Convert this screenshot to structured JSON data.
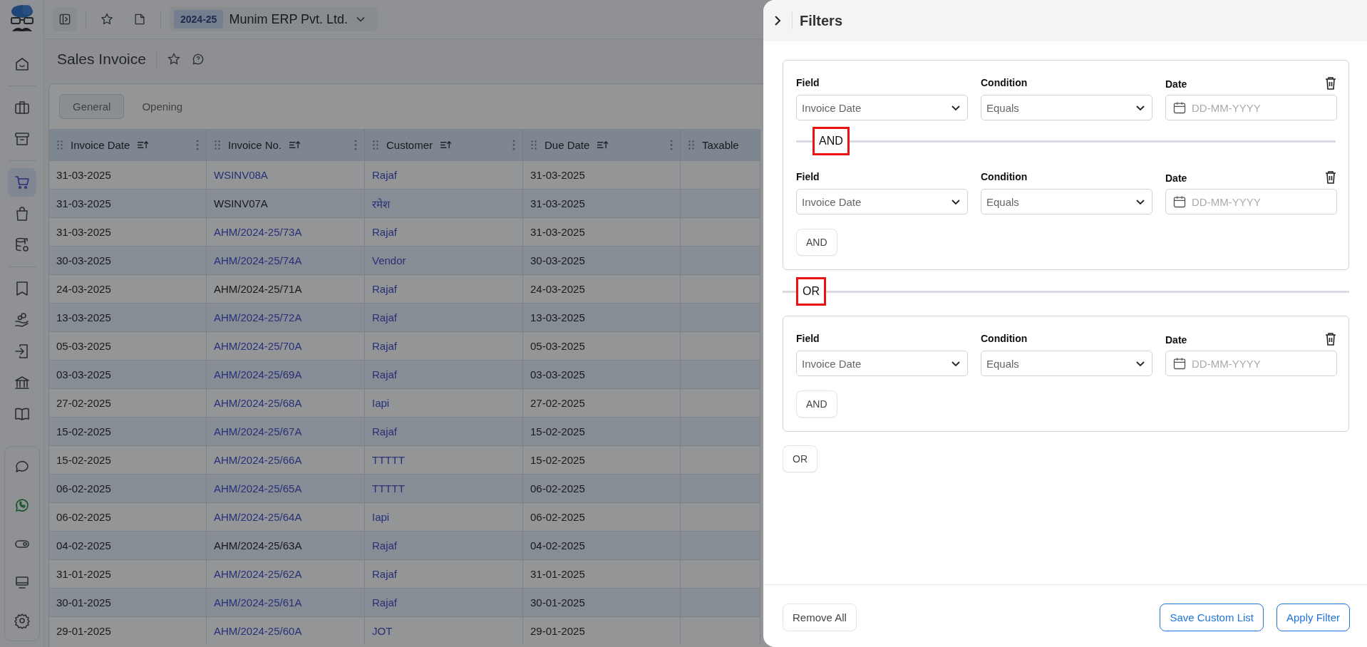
{
  "topbar": {
    "fiscal_year": "2024-25",
    "company": "Munim ERP Pvt. Ltd."
  },
  "sidebar": {
    "items": [
      {
        "selected": false
      },
      {
        "selected": false
      },
      {
        "selected": false
      },
      {
        "selected": true
      },
      {
        "selected": false
      },
      {
        "selected": false
      },
      {
        "selected": false
      },
      {
        "selected": false
      },
      {
        "selected": false
      },
      {
        "selected": false
      },
      {
        "selected": false
      }
    ],
    "bottom_items": [
      {
        "selected": false
      },
      {
        "selected": false
      },
      {
        "selected": false
      },
      {
        "selected": false
      },
      {
        "selected": false
      }
    ]
  },
  "page": {
    "title": "Sales Invoice"
  },
  "tabs": [
    {
      "label": "General",
      "selected": true
    },
    {
      "label": "Opening",
      "selected": false
    }
  ],
  "table": {
    "columns": [
      "Invoice Date",
      "Invoice No.",
      "Customer",
      "Due Date",
      "Taxable"
    ],
    "rows": [
      {
        "invoice_date": "31-03-2025",
        "invoice_no": "WSINV08A",
        "invoice_no_linked": true,
        "customer": "Rajaf",
        "due_date": "31-03-2025"
      },
      {
        "invoice_date": "31-03-2025",
        "invoice_no": "WSINV07A",
        "invoice_no_linked": false,
        "customer": "रमेश",
        "due_date": "31-03-2025"
      },
      {
        "invoice_date": "31-03-2025",
        "invoice_no": "AHM/2024-25/73A",
        "invoice_no_linked": true,
        "customer": "Rajaf",
        "due_date": "31-03-2025"
      },
      {
        "invoice_date": "30-03-2025",
        "invoice_no": "AHM/2024-25/74A",
        "invoice_no_linked": true,
        "customer": "Vendor",
        "due_date": "30-03-2025"
      },
      {
        "invoice_date": "24-03-2025",
        "invoice_no": "AHM/2024-25/71A",
        "invoice_no_linked": false,
        "customer": "Rajaf",
        "due_date": "24-03-2025"
      },
      {
        "invoice_date": "13-03-2025",
        "invoice_no": "AHM/2024-25/72A",
        "invoice_no_linked": true,
        "customer": "Rajaf",
        "due_date": "13-03-2025"
      },
      {
        "invoice_date": "05-03-2025",
        "invoice_no": "AHM/2024-25/70A",
        "invoice_no_linked": true,
        "customer": "Rajaf",
        "due_date": "05-03-2025"
      },
      {
        "invoice_date": "03-03-2025",
        "invoice_no": "AHM/2024-25/69A",
        "invoice_no_linked": true,
        "customer": "Rajaf",
        "due_date": "03-03-2025"
      },
      {
        "invoice_date": "27-02-2025",
        "invoice_no": "AHM/2024-25/68A",
        "invoice_no_linked": true,
        "customer": "Iapi",
        "due_date": "27-02-2025"
      },
      {
        "invoice_date": "15-02-2025",
        "invoice_no": "AHM/2024-25/67A",
        "invoice_no_linked": true,
        "customer": "Rajaf",
        "due_date": "15-02-2025"
      },
      {
        "invoice_date": "15-02-2025",
        "invoice_no": "AHM/2024-25/66A",
        "invoice_no_linked": true,
        "customer": "TTTTT",
        "due_date": "15-02-2025"
      },
      {
        "invoice_date": "06-02-2025",
        "invoice_no": "AHM/2024-25/65A",
        "invoice_no_linked": true,
        "customer": "TTTTT",
        "due_date": "06-02-2025"
      },
      {
        "invoice_date": "06-02-2025",
        "invoice_no": "AHM/2024-25/64A",
        "invoice_no_linked": true,
        "customer": "Iapi",
        "due_date": "06-02-2025"
      },
      {
        "invoice_date": "04-02-2025",
        "invoice_no": "AHM/2024-25/63A",
        "invoice_no_linked": false,
        "customer": "Rajaf",
        "due_date": "04-02-2025"
      },
      {
        "invoice_date": "31-01-2025",
        "invoice_no": "AHM/2024-25/62A",
        "invoice_no_linked": true,
        "customer": "Rajaf",
        "due_date": "31-01-2025"
      },
      {
        "invoice_date": "30-01-2025",
        "invoice_no": "AHM/2024-25/61A",
        "invoice_no_linked": true,
        "customer": "Rajaf",
        "due_date": "30-01-2025"
      },
      {
        "invoice_date": "29-01-2025",
        "invoice_no": "AHM/2024-25/60A",
        "invoice_no_linked": true,
        "customer": "JOT",
        "due_date": "29-01-2025"
      }
    ]
  },
  "filters": {
    "title": "Filters",
    "groups": [
      {
        "conditions": [
          {
            "field_label": "Field",
            "field": "Invoice Date",
            "condition_label": "Condition",
            "condition": "Equals",
            "value_label": "Date",
            "placeholder": "DD-MM-YYYY"
          },
          {
            "joiner": {
              "label": "AND",
              "highlighted": true
            },
            "field_label": "Field",
            "field": "Invoice Date",
            "condition_label": "Condition",
            "condition": "Equals",
            "value_label": "Date",
            "placeholder": "DD-MM-YYYY"
          }
        ],
        "add_button": "AND"
      },
      {
        "joiner": {
          "label": "OR",
          "highlighted": true
        },
        "conditions": [
          {
            "field_label": "Field",
            "field": "Invoice Date",
            "condition_label": "Condition",
            "condition": "Equals",
            "value_label": "Date",
            "placeholder": "DD-MM-YYYY"
          }
        ],
        "add_button": "AND"
      }
    ],
    "add_group_button": "OR",
    "footer": {
      "remove_all": "Remove All",
      "save_custom_list": "Save Custom List",
      "apply": "Apply Filter"
    }
  }
}
